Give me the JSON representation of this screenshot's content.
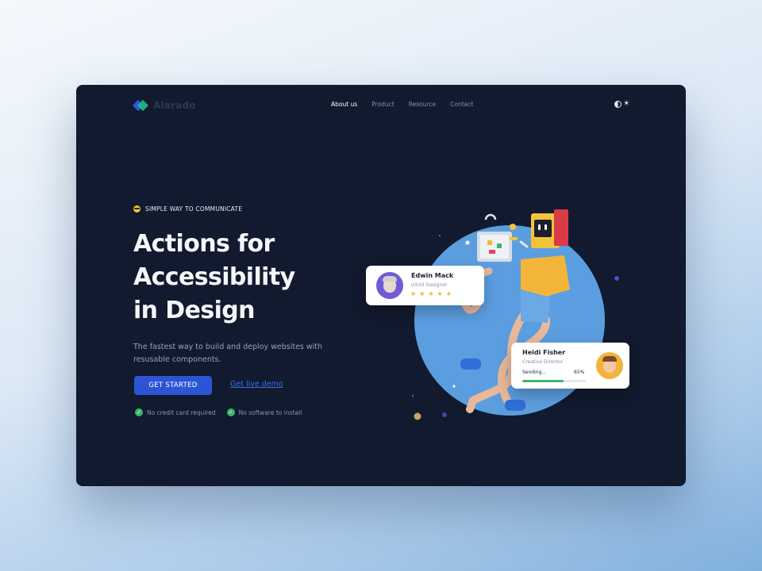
{
  "brand": {
    "name": "Alarado",
    "accent": "#2c55d6",
    "secondary": "#27b889"
  },
  "nav": {
    "items": [
      {
        "label": "About us",
        "active": true
      },
      {
        "label": "Product",
        "active": false
      },
      {
        "label": "Resource",
        "active": false
      },
      {
        "label": "Contact",
        "active": false
      }
    ],
    "theme_toggle_icon": "moon-sun-icon"
  },
  "hero": {
    "tagline": "SIMPLE WAY TO COMMUNICATE",
    "tagline_icon": "sunglasses-emoji-icon",
    "headline_lines": [
      "Actions for",
      "Accessibility",
      "in Design"
    ],
    "subtext": "The fastest way to build and deploy websites with resusable components.",
    "cta_label": "GET STARTED",
    "demo_link": "Get live demo",
    "checks": [
      {
        "icon": "check-circle-icon",
        "label": "No credit card required"
      },
      {
        "icon": "check-circle-icon",
        "label": "No software to install"
      }
    ]
  },
  "cards": {
    "edwin": {
      "name": "Edwin Mack",
      "role": "UX/UI Designer",
      "rating": 5
    },
    "heidi": {
      "name": "Heidi Fisher",
      "role": "Creative Director",
      "status": "Sending...",
      "progress_label": "65%",
      "progress": 0.65
    }
  },
  "colors": {
    "background": "#111a2e",
    "circle": "#5b9ee0",
    "success": "#3fb36a",
    "star": "#f3b02f"
  }
}
